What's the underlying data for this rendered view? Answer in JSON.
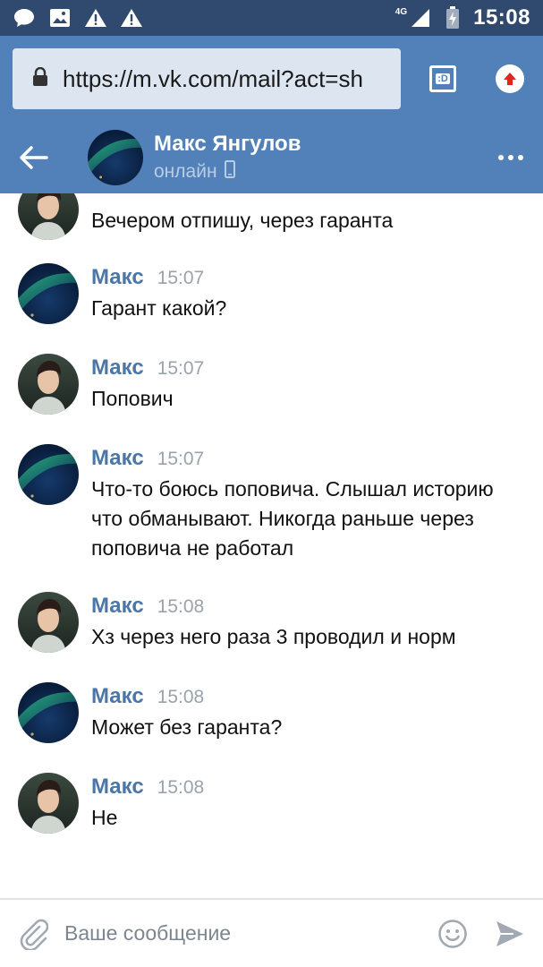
{
  "status_bar": {
    "time": "15:08",
    "network": "4G",
    "icons": [
      "chat-bubble-icon",
      "image-icon",
      "warning-icon",
      "warning-icon",
      "signal-icon",
      "battery-icon"
    ]
  },
  "browser": {
    "url": "https://m.vk.com/mail?act=sh",
    "tab_label": ":D",
    "icons": [
      "lock-icon",
      "tabs-icon",
      "upload-icon"
    ]
  },
  "chat_header": {
    "name": "Макс Янгулов",
    "status": "онлайн",
    "icons": [
      "back-arrow-icon",
      "mobile-icon",
      "more-icon"
    ]
  },
  "messages": [
    {
      "author": "",
      "time": "",
      "text": "Вечером отпишу, через гаранта",
      "avatar": "portrait",
      "partial": true
    },
    {
      "author": "Макс",
      "time": "15:07",
      "text": "Гарант какой?",
      "avatar": "aurora"
    },
    {
      "author": "Макс",
      "time": "15:07",
      "text": "Попович",
      "avatar": "portrait"
    },
    {
      "author": "Макс",
      "time": "15:07",
      "text": "Что-то боюсь поповича. Слышал историю что обманывают. Никогда раньше через поповича не работал",
      "avatar": "aurora"
    },
    {
      "author": "Макс",
      "time": "15:08",
      "text": "Хз через него раза 3 проводил и норм",
      "avatar": "portrait"
    },
    {
      "author": "Макс",
      "time": "15:08",
      "text": "Может без гаранта?",
      "avatar": "aurora"
    },
    {
      "author": "Макс",
      "time": "15:08",
      "text": "Не",
      "avatar": "portrait"
    }
  ],
  "composer": {
    "placeholder": "Ваше сообщение",
    "icons": [
      "paperclip-icon",
      "smile-icon",
      "send-icon"
    ]
  },
  "colors": {
    "status_bar": "#2f4a6e",
    "header": "#5181b8",
    "author": "#4a76a8",
    "time": "#9aa3ad"
  }
}
